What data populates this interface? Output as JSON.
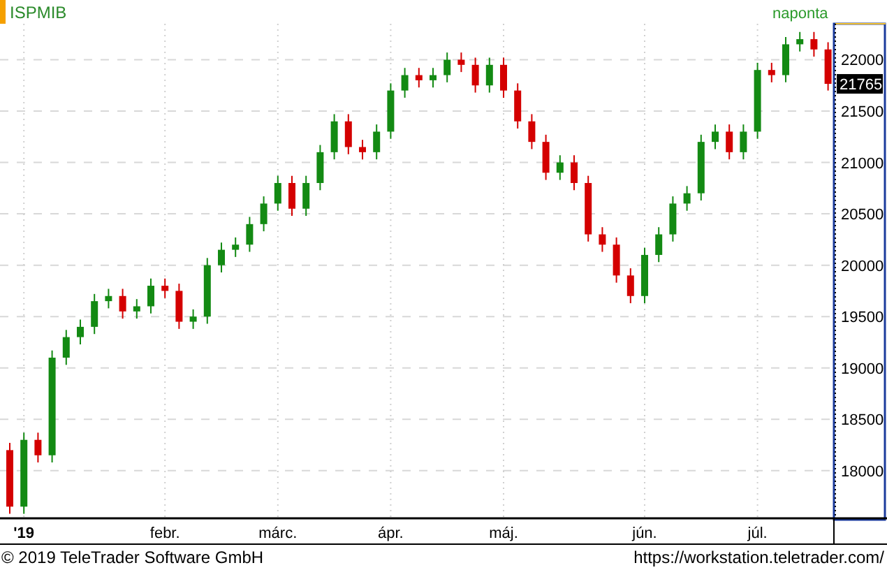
{
  "chart": {
    "symbol": "ISPMIB",
    "interval": "naponta",
    "last_price": "21765",
    "chart_data": {
      "type": "candlestick",
      "grid": true,
      "ylim": [
        17550,
        22350
      ],
      "yticks": [
        22000,
        21500,
        21000,
        20500,
        20000,
        19500,
        19000,
        18500,
        18000
      ],
      "categories": [
        null,
        "'19",
        null,
        null,
        null,
        null,
        null,
        null,
        null,
        null,
        null,
        "febr.",
        null,
        null,
        null,
        null,
        null,
        null,
        null,
        "márc.",
        null,
        null,
        null,
        null,
        null,
        null,
        null,
        "ápr.",
        null,
        null,
        null,
        null,
        null,
        null,
        null,
        "máj.",
        null,
        null,
        null,
        null,
        null,
        null,
        null,
        null,
        null,
        "jún.",
        null,
        null,
        null,
        null,
        null,
        null,
        null,
        "júl.",
        null,
        null,
        null,
        null,
        null
      ],
      "ohlc": [
        [
          18200,
          18270,
          17580,
          17650
        ],
        [
          17650,
          18370,
          17580,
          18300
        ],
        [
          18300,
          18370,
          18080,
          18150
        ],
        [
          18150,
          19170,
          18080,
          19100
        ],
        [
          19100,
          19370,
          19030,
          19300
        ],
        [
          19300,
          19470,
          19230,
          19400
        ],
        [
          19400,
          19720,
          19330,
          19650
        ],
        [
          19650,
          19770,
          19580,
          19700
        ],
        [
          19700,
          19770,
          19480,
          19550
        ],
        [
          19550,
          19670,
          19480,
          19600
        ],
        [
          19600,
          19870,
          19530,
          19800
        ],
        [
          19800,
          19870,
          19680,
          19750
        ],
        [
          19750,
          19820,
          19380,
          19450
        ],
        [
          19450,
          19570,
          19380,
          19500
        ],
        [
          19500,
          20070,
          19430,
          20000
        ],
        [
          20000,
          20220,
          19930,
          20150
        ],
        [
          20150,
          20270,
          20080,
          20200
        ],
        [
          20200,
          20470,
          20130,
          20400
        ],
        [
          20400,
          20670,
          20330,
          20600
        ],
        [
          20600,
          20870,
          20530,
          20800
        ],
        [
          20800,
          20870,
          20480,
          20550
        ],
        [
          20550,
          20870,
          20480,
          20800
        ],
        [
          20800,
          21170,
          20730,
          21100
        ],
        [
          21100,
          21470,
          21030,
          21400
        ],
        [
          21400,
          21470,
          21080,
          21150
        ],
        [
          21150,
          21220,
          21030,
          21100
        ],
        [
          21100,
          21370,
          21030,
          21300
        ],
        [
          21300,
          21770,
          21230,
          21700
        ],
        [
          21700,
          21920,
          21630,
          21850
        ],
        [
          21850,
          21920,
          21730,
          21800
        ],
        [
          21800,
          21920,
          21730,
          21850
        ],
        [
          21850,
          22070,
          21780,
          22000
        ],
        [
          22000,
          22070,
          21880,
          21950
        ],
        [
          21950,
          22020,
          21680,
          21750
        ],
        [
          21750,
          22020,
          21680,
          21950
        ],
        [
          21950,
          22020,
          21630,
          21700
        ],
        [
          21700,
          21770,
          21330,
          21400
        ],
        [
          21400,
          21470,
          21130,
          21200
        ],
        [
          21200,
          21270,
          20830,
          20900
        ],
        [
          20900,
          21070,
          20830,
          21000
        ],
        [
          21000,
          21070,
          20730,
          20800
        ],
        [
          20800,
          20870,
          20230,
          20300
        ],
        [
          20300,
          20370,
          20130,
          20200
        ],
        [
          20200,
          20270,
          19830,
          19900
        ],
        [
          19900,
          19970,
          19630,
          19700
        ],
        [
          19700,
          20170,
          19630,
          20100
        ],
        [
          20100,
          20370,
          20030,
          20300
        ],
        [
          20300,
          20670,
          20230,
          20600
        ],
        [
          20600,
          20770,
          20530,
          20700
        ],
        [
          20700,
          21270,
          20630,
          21200
        ],
        [
          21200,
          21370,
          21130,
          21300
        ],
        [
          21300,
          21370,
          21030,
          21100
        ],
        [
          21100,
          21370,
          21030,
          21300
        ],
        [
          21300,
          21970,
          21230,
          21900
        ],
        [
          21900,
          21970,
          21780,
          21850
        ],
        [
          21850,
          22220,
          21780,
          22150
        ],
        [
          22150,
          22270,
          22080,
          22200
        ],
        [
          22200,
          22270,
          22030,
          22100
        ],
        [
          22100,
          22170,
          21700,
          21765
        ]
      ]
    }
  },
  "footer": {
    "copyright": "© 2019 TeleTrader Software GmbH",
    "url": "https://workstation.teletrader.com/"
  }
}
